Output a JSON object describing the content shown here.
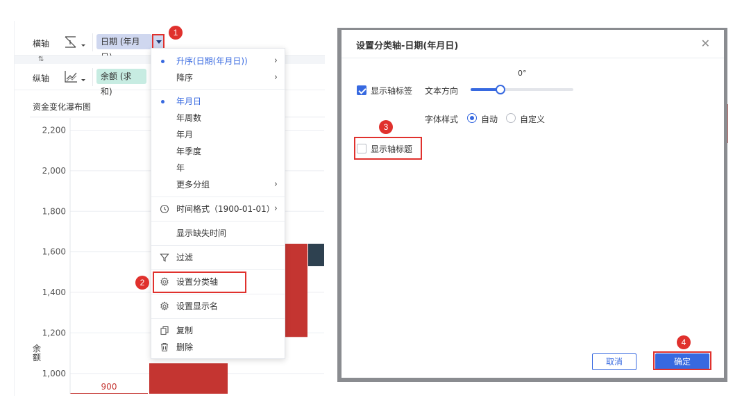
{
  "axis": {
    "x_label": "横轴",
    "y_label": "纵轴",
    "x_field": "日期 (年月日)",
    "y_field": "余额 (求和)",
    "swap_icon": "swap-vertical-icon"
  },
  "chart": {
    "title": "资金变化瀑布图",
    "ylabel_char1": "余",
    "ylabel_char2": "额",
    "bar_label": "900"
  },
  "chart_data": {
    "type": "bar",
    "title": "资金变化瀑布图",
    "ylabel": "余额",
    "yticks": [
      "2,200",
      "2,000",
      "1,800",
      "1,600",
      "1,400",
      "1,200",
      "1,000"
    ],
    "ylim": [
      900,
      2260
    ],
    "bars": [
      {
        "label": "900",
        "bottom": 900,
        "top": 900,
        "color": "#c43531"
      },
      {
        "bottom": 900,
        "top": 1050,
        "color": "#c43531"
      },
      {
        "bottom": 1180,
        "top": 1640,
        "color": "#c43531"
      },
      {
        "bottom": 1530,
        "top": 1640,
        "color": "#2e4150"
      }
    ],
    "grid": true
  },
  "menu": {
    "items": [
      {
        "label": "升序(日期(年月日))",
        "selected": true,
        "submenu": true
      },
      {
        "label": "降序",
        "selected": false,
        "submenu": true
      },
      {
        "label": "年月日",
        "selected": true,
        "submenu": false
      },
      {
        "label": "年周数",
        "selected": false,
        "submenu": false
      },
      {
        "label": "年月",
        "selected": false,
        "submenu": false
      },
      {
        "label": "年季度",
        "selected": false,
        "submenu": false
      },
      {
        "label": "年",
        "selected": false,
        "submenu": false
      },
      {
        "label": "更多分组",
        "selected": false,
        "submenu": true
      },
      {
        "label": "时间格式（1900-01-01）",
        "selected": false,
        "submenu": true,
        "icon": "clock-icon"
      },
      {
        "label": "显示缺失时间",
        "selected": false,
        "submenu": false
      },
      {
        "label": "过滤",
        "selected": false,
        "submenu": false,
        "icon": "filter-icon"
      },
      {
        "label": "设置分类轴",
        "selected": false,
        "submenu": false,
        "icon": "gear-icon"
      },
      {
        "label": "设置显示名",
        "selected": false,
        "submenu": false,
        "icon": "gear-icon"
      },
      {
        "label": "复制",
        "selected": false,
        "submenu": false,
        "icon": "copy-icon"
      },
      {
        "label": "删除",
        "selected": false,
        "submenu": false,
        "icon": "trash-icon"
      }
    ]
  },
  "dialog": {
    "title": "设置分类轴-日期(年月日)",
    "close_icon": "close-icon",
    "show_axis_labels": {
      "label": "显示轴标签",
      "checked": true
    },
    "text_direction": {
      "label": "文本方向",
      "value": "0°",
      "angle": 0
    },
    "font_style": {
      "label": "字体样式",
      "options": [
        "自动",
        "自定义"
      ],
      "selected": "自动"
    },
    "show_axis_title": {
      "label": "显示轴标题",
      "checked": false
    },
    "cancel_label": "取消",
    "ok_label": "确定"
  },
  "annotations": {
    "steps": [
      "1",
      "2",
      "3",
      "4"
    ],
    "color": "#e0312d"
  },
  "colors": {
    "accent": "#3769e0",
    "bar_red": "#c43531",
    "bar_dark": "#2e4150"
  }
}
